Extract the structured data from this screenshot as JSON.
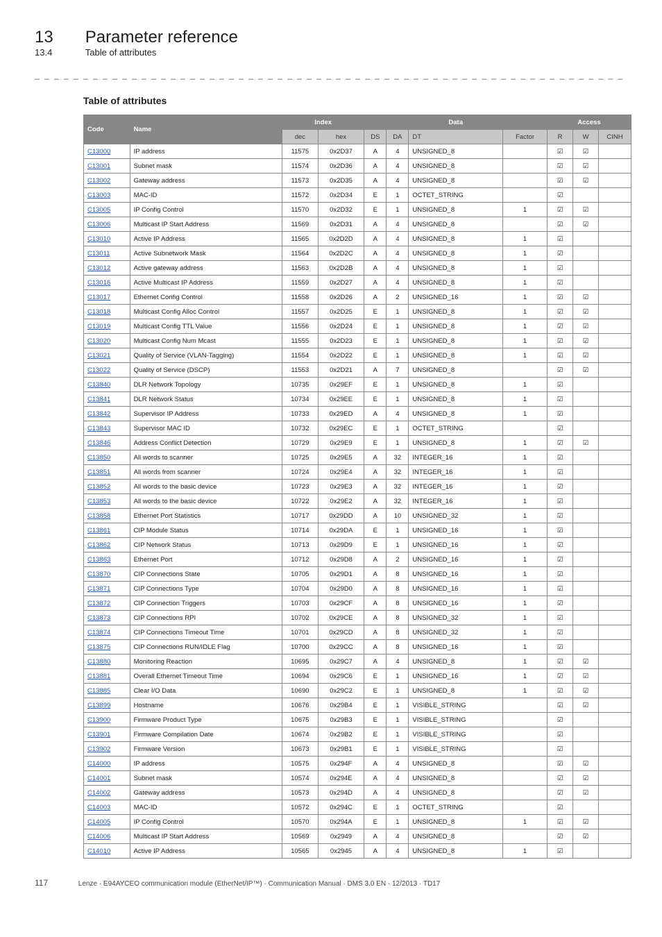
{
  "chapter": {
    "num": "13",
    "title": "Parameter reference"
  },
  "subsection": {
    "num": "13.4",
    "title": "Table of attributes"
  },
  "heading": "Table of attributes",
  "columns": {
    "code": "Code",
    "name": "Name",
    "index": "Index",
    "data": "Data",
    "access": "Access",
    "dec": "dec",
    "hex": "hex",
    "ds": "DS",
    "da": "DA",
    "dt": "DT",
    "factor": "Factor",
    "r": "R",
    "w": "W",
    "cinh": "CINH"
  },
  "rows": [
    {
      "code": "C13000",
      "name": "IP address",
      "dec": "11575",
      "hex": "0x2D37",
      "ds": "A",
      "da": "4",
      "dt": "UNSIGNED_8",
      "factor": "",
      "r": true,
      "w": true,
      "cinh": false
    },
    {
      "code": "C13001",
      "name": "Subnet mask",
      "dec": "11574",
      "hex": "0x2D36",
      "ds": "A",
      "da": "4",
      "dt": "UNSIGNED_8",
      "factor": "",
      "r": true,
      "w": true,
      "cinh": false
    },
    {
      "code": "C13002",
      "name": "Gateway address",
      "dec": "11573",
      "hex": "0x2D35",
      "ds": "A",
      "da": "4",
      "dt": "UNSIGNED_8",
      "factor": "",
      "r": true,
      "w": true,
      "cinh": false
    },
    {
      "code": "C13003",
      "name": "MAC-ID",
      "dec": "11572",
      "hex": "0x2D34",
      "ds": "E",
      "da": "1",
      "dt": "OCTET_STRING",
      "factor": "",
      "r": true,
      "w": false,
      "cinh": false
    },
    {
      "code": "C13005",
      "name": "IP Config Control",
      "dec": "11570",
      "hex": "0x2D32",
      "ds": "E",
      "da": "1",
      "dt": "UNSIGNED_8",
      "factor": "1",
      "r": true,
      "w": true,
      "cinh": false
    },
    {
      "code": "C13006",
      "name": "Multicast IP Start Address",
      "dec": "11569",
      "hex": "0x2D31",
      "ds": "A",
      "da": "4",
      "dt": "UNSIGNED_8",
      "factor": "",
      "r": true,
      "w": true,
      "cinh": false
    },
    {
      "code": "C13010",
      "name": "Active IP Address",
      "dec": "11565",
      "hex": "0x2D2D",
      "ds": "A",
      "da": "4",
      "dt": "UNSIGNED_8",
      "factor": "1",
      "r": true,
      "w": false,
      "cinh": false
    },
    {
      "code": "C13011",
      "name": "Active Subnetwork Mask",
      "dec": "11564",
      "hex": "0x2D2C",
      "ds": "A",
      "da": "4",
      "dt": "UNSIGNED_8",
      "factor": "1",
      "r": true,
      "w": false,
      "cinh": false
    },
    {
      "code": "C13012",
      "name": "Active gateway address",
      "dec": "11563",
      "hex": "0x2D2B",
      "ds": "A",
      "da": "4",
      "dt": "UNSIGNED_8",
      "factor": "1",
      "r": true,
      "w": false,
      "cinh": false
    },
    {
      "code": "C13016",
      "name": "Active Multicast IP Address",
      "dec": "11559",
      "hex": "0x2D27",
      "ds": "A",
      "da": "4",
      "dt": "UNSIGNED_8",
      "factor": "1",
      "r": true,
      "w": false,
      "cinh": false
    },
    {
      "code": "C13017",
      "name": "Ethernet Config Control",
      "dec": "11558",
      "hex": "0x2D26",
      "ds": "A",
      "da": "2",
      "dt": "UNSIGNED_16",
      "factor": "1",
      "r": true,
      "w": true,
      "cinh": false
    },
    {
      "code": "C13018",
      "name": "Multicast Config Alloc Control",
      "dec": "11557",
      "hex": "0x2D25",
      "ds": "E",
      "da": "1",
      "dt": "UNSIGNED_8",
      "factor": "1",
      "r": true,
      "w": true,
      "cinh": false
    },
    {
      "code": "C13019",
      "name": "Multicast Config TTL Value",
      "dec": "11556",
      "hex": "0x2D24",
      "ds": "E",
      "da": "1",
      "dt": "UNSIGNED_8",
      "factor": "1",
      "r": true,
      "w": true,
      "cinh": false
    },
    {
      "code": "C13020",
      "name": "Multicast Config Num Mcast",
      "dec": "11555",
      "hex": "0x2D23",
      "ds": "E",
      "da": "1",
      "dt": "UNSIGNED_8",
      "factor": "1",
      "r": true,
      "w": true,
      "cinh": false
    },
    {
      "code": "C13021",
      "name": "Quality of Service (VLAN-Tagging)",
      "dec": "11554",
      "hex": "0x2D22",
      "ds": "E",
      "da": "1",
      "dt": "UNSIGNED_8",
      "factor": "1",
      "r": true,
      "w": true,
      "cinh": false
    },
    {
      "code": "C13022",
      "name": "Quality of Service (DSCP)",
      "dec": "11553",
      "hex": "0x2D21",
      "ds": "A",
      "da": "7",
      "dt": "UNSIGNED_8",
      "factor": "",
      "r": true,
      "w": true,
      "cinh": false
    },
    {
      "code": "C13840",
      "name": "DLR Network Topology",
      "dec": "10735",
      "hex": "0x29EF",
      "ds": "E",
      "da": "1",
      "dt": "UNSIGNED_8",
      "factor": "1",
      "r": true,
      "w": false,
      "cinh": false
    },
    {
      "code": "C13841",
      "name": "DLR Network Status",
      "dec": "10734",
      "hex": "0x29EE",
      "ds": "E",
      "da": "1",
      "dt": "UNSIGNED_8",
      "factor": "1",
      "r": true,
      "w": false,
      "cinh": false
    },
    {
      "code": "C13842",
      "name": "Supervisor IP Address",
      "dec": "10733",
      "hex": "0x29ED",
      "ds": "A",
      "da": "4",
      "dt": "UNSIGNED_8",
      "factor": "1",
      "r": true,
      "w": false,
      "cinh": false
    },
    {
      "code": "C13843",
      "name": "Supervisor MAC ID",
      "dec": "10732",
      "hex": "0x29EC",
      "ds": "E",
      "da": "1",
      "dt": "OCTET_STRING",
      "factor": "",
      "r": true,
      "w": false,
      "cinh": false
    },
    {
      "code": "C13846",
      "name": "Address Conflict Detection",
      "dec": "10729",
      "hex": "0x29E9",
      "ds": "E",
      "da": "1",
      "dt": "UNSIGNED_8",
      "factor": "1",
      "r": true,
      "w": true,
      "cinh": false
    },
    {
      "code": "C13850",
      "name": "All words to scanner",
      "dec": "10725",
      "hex": "0x29E5",
      "ds": "A",
      "da": "32",
      "dt": "INTEGER_16",
      "factor": "1",
      "r": true,
      "w": false,
      "cinh": false
    },
    {
      "code": "C13851",
      "name": "All words from scanner",
      "dec": "10724",
      "hex": "0x29E4",
      "ds": "A",
      "da": "32",
      "dt": "INTEGER_16",
      "factor": "1",
      "r": true,
      "w": false,
      "cinh": false
    },
    {
      "code": "C13852",
      "name": "All words to the basic device",
      "dec": "10723",
      "hex": "0x29E3",
      "ds": "A",
      "da": "32",
      "dt": "INTEGER_16",
      "factor": "1",
      "r": true,
      "w": false,
      "cinh": false
    },
    {
      "code": "C13853",
      "name": "All words to the basic device",
      "dec": "10722",
      "hex": "0x29E2",
      "ds": "A",
      "da": "32",
      "dt": "INTEGER_16",
      "factor": "1",
      "r": true,
      "w": false,
      "cinh": false
    },
    {
      "code": "C13858",
      "name": "Ethernet Port Statistics",
      "dec": "10717",
      "hex": "0x29DD",
      "ds": "A",
      "da": "10",
      "dt": "UNSIGNED_32",
      "factor": "1",
      "r": true,
      "w": false,
      "cinh": false
    },
    {
      "code": "C13861",
      "name": "CIP Module Status",
      "dec": "10714",
      "hex": "0x29DA",
      "ds": "E",
      "da": "1",
      "dt": "UNSIGNED_16",
      "factor": "1",
      "r": true,
      "w": false,
      "cinh": false
    },
    {
      "code": "C13862",
      "name": "CIP Network Status",
      "dec": "10713",
      "hex": "0x29D9",
      "ds": "E",
      "da": "1",
      "dt": "UNSIGNED_16",
      "factor": "1",
      "r": true,
      "w": false,
      "cinh": false
    },
    {
      "code": "C13863",
      "name": "Ethernet Port",
      "dec": "10712",
      "hex": "0x29D8",
      "ds": "A",
      "da": "2",
      "dt": "UNSIGNED_16",
      "factor": "1",
      "r": true,
      "w": false,
      "cinh": false
    },
    {
      "code": "C13870",
      "name": "CIP Connections State",
      "dec": "10705",
      "hex": "0x29D1",
      "ds": "A",
      "da": "8",
      "dt": "UNSIGNED_16",
      "factor": "1",
      "r": true,
      "w": false,
      "cinh": false
    },
    {
      "code": "C13871",
      "name": "CIP Connections Type",
      "dec": "10704",
      "hex": "0x29D0",
      "ds": "A",
      "da": "8",
      "dt": "UNSIGNED_16",
      "factor": "1",
      "r": true,
      "w": false,
      "cinh": false
    },
    {
      "code": "C13872",
      "name": "CIP Connection Triggers",
      "dec": "10703",
      "hex": "0x29CF",
      "ds": "A",
      "da": "8",
      "dt": "UNSIGNED_16",
      "factor": "1",
      "r": true,
      "w": false,
      "cinh": false
    },
    {
      "code": "C13873",
      "name": "CIP Connections RPI",
      "dec": "10702",
      "hex": "0x29CE",
      "ds": "A",
      "da": "8",
      "dt": "UNSIGNED_32",
      "factor": "1",
      "r": true,
      "w": false,
      "cinh": false
    },
    {
      "code": "C13874",
      "name": "CIP Connections Timeout Time",
      "dec": "10701",
      "hex": "0x29CD",
      "ds": "A",
      "da": "8",
      "dt": "UNSIGNED_32",
      "factor": "1",
      "r": true,
      "w": false,
      "cinh": false
    },
    {
      "code": "C13875",
      "name": "CIP Connections RUN/IDLE Flag",
      "dec": "10700",
      "hex": "0x29CC",
      "ds": "A",
      "da": "8",
      "dt": "UNSIGNED_16",
      "factor": "1",
      "r": true,
      "w": false,
      "cinh": false
    },
    {
      "code": "C13880",
      "name": "Monitoring Reaction",
      "dec": "10695",
      "hex": "0x29C7",
      "ds": "A",
      "da": "4",
      "dt": "UNSIGNED_8",
      "factor": "1",
      "r": true,
      "w": true,
      "cinh": false
    },
    {
      "code": "C13881",
      "name": "Overall Ethernet Timeout Time",
      "dec": "10694",
      "hex": "0x29C6",
      "ds": "E",
      "da": "1",
      "dt": "UNSIGNED_16",
      "factor": "1",
      "r": true,
      "w": true,
      "cinh": false
    },
    {
      "code": "C13885",
      "name": "Clear I/O Data",
      "dec": "10690",
      "hex": "0x29C2",
      "ds": "E",
      "da": "1",
      "dt": "UNSIGNED_8",
      "factor": "1",
      "r": true,
      "w": true,
      "cinh": false
    },
    {
      "code": "C13899",
      "name": "Hostname",
      "dec": "10676",
      "hex": "0x29B4",
      "ds": "E",
      "da": "1",
      "dt": "VISIBLE_STRING",
      "factor": "",
      "r": true,
      "w": true,
      "cinh": false
    },
    {
      "code": "C13900",
      "name": "Firmware Product Type",
      "dec": "10675",
      "hex": "0x29B3",
      "ds": "E",
      "da": "1",
      "dt": "VISIBLE_STRING",
      "factor": "",
      "r": true,
      "w": false,
      "cinh": false
    },
    {
      "code": "C13901",
      "name": "Firmware Compilation Date",
      "dec": "10674",
      "hex": "0x29B2",
      "ds": "E",
      "da": "1",
      "dt": "VISIBLE_STRING",
      "factor": "",
      "r": true,
      "w": false,
      "cinh": false
    },
    {
      "code": "C13902",
      "name": "Firmware Version",
      "dec": "10673",
      "hex": "0x29B1",
      "ds": "E",
      "da": "1",
      "dt": "VISIBLE_STRING",
      "factor": "",
      "r": true,
      "w": false,
      "cinh": false
    },
    {
      "code": "C14000",
      "name": "IP address",
      "dec": "10575",
      "hex": "0x294F",
      "ds": "A",
      "da": "4",
      "dt": "UNSIGNED_8",
      "factor": "",
      "r": true,
      "w": true,
      "cinh": false
    },
    {
      "code": "C14001",
      "name": "Subnet mask",
      "dec": "10574",
      "hex": "0x294E",
      "ds": "A",
      "da": "4",
      "dt": "UNSIGNED_8",
      "factor": "",
      "r": true,
      "w": true,
      "cinh": false
    },
    {
      "code": "C14002",
      "name": "Gateway address",
      "dec": "10573",
      "hex": "0x294D",
      "ds": "A",
      "da": "4",
      "dt": "UNSIGNED_8",
      "factor": "",
      "r": true,
      "w": true,
      "cinh": false
    },
    {
      "code": "C14003",
      "name": "MAC-ID",
      "dec": "10572",
      "hex": "0x294C",
      "ds": "E",
      "da": "1",
      "dt": "OCTET_STRING",
      "factor": "",
      "r": true,
      "w": false,
      "cinh": false
    },
    {
      "code": "C14005",
      "name": "IP Config Control",
      "dec": "10570",
      "hex": "0x294A",
      "ds": "E",
      "da": "1",
      "dt": "UNSIGNED_8",
      "factor": "1",
      "r": true,
      "w": true,
      "cinh": false
    },
    {
      "code": "C14006",
      "name": "Multicast IP Start Address",
      "dec": "10569",
      "hex": "0x2949",
      "ds": "A",
      "da": "4",
      "dt": "UNSIGNED_8",
      "factor": "",
      "r": true,
      "w": true,
      "cinh": false
    },
    {
      "code": "C14010",
      "name": "Active IP Address",
      "dec": "10565",
      "hex": "0x2945",
      "ds": "A",
      "da": "4",
      "dt": "UNSIGNED_8",
      "factor": "1",
      "r": true,
      "w": false,
      "cinh": false
    }
  ],
  "footer": {
    "page": "117",
    "text": "Lenze · E94AYCEO communication module (EtherNet/IP™) · Communication Manual · DMS 3.0 EN · 12/2013 · TD17"
  },
  "checkmark": "☑"
}
